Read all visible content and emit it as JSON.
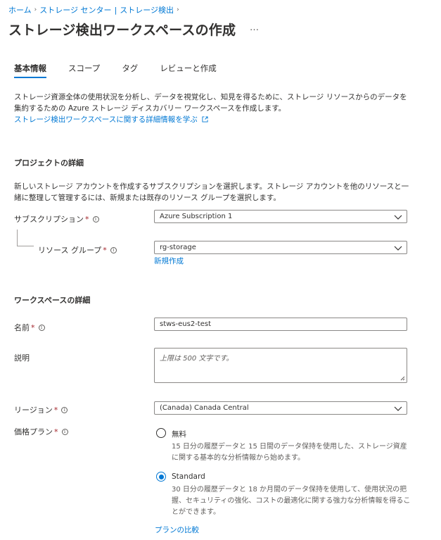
{
  "breadcrumb": {
    "home": "ホーム",
    "storage_center": "ストレージ センター",
    "separator_mid": "|",
    "storage_discovery": "ストレージ検出"
  },
  "page": {
    "title": "ストレージ検出ワークスペースの作成",
    "more": "…"
  },
  "tabs": [
    {
      "label": "基本情報",
      "active": true
    },
    {
      "label": "スコープ"
    },
    {
      "label": "タグ"
    },
    {
      "label": "レビューと作成"
    }
  ],
  "intro": {
    "text": "ストレージ資源全体の使用状況を分析し、データを視覚化し、知見を得るために、ストレージ リソースからのデータを集約するための Azure ストレージ ディスカバリー ワークスペースを作成します。",
    "link": "ストレージ検出ワークスペースに関する詳細情報を学ぶ"
  },
  "project": {
    "heading": "プロジェクトの詳細",
    "description": "新しいストレージ アカウントを作成するサブスクリプションを選択します。ストレージ アカウントを他のリソースと一緒に整理して管理するには、新規または既存のリソース グループを選択します。",
    "subscription_label": "サブスクリプション",
    "subscription_value": "Azure Subscription 1",
    "resource_group_label": "リソース グループ",
    "resource_group_value": "rg-storage",
    "create_new": "新規作成"
  },
  "workspace": {
    "heading": "ワークスペースの詳細",
    "name_label": "名前",
    "name_value": "stws-eus2-test",
    "description_label": "説明",
    "description_placeholder": "上限は 500 文字です。",
    "region_label": "リージョン",
    "region_value": "(Canada) Canada Central",
    "pricing_label": "価格プラン",
    "plans": [
      {
        "name": "無料",
        "description": "15 日分の履歴データと 15 日間のデータ保持を使用した、ストレージ資産に関する基本的な分析情報から始めます。",
        "selected": false
      },
      {
        "name": "Standard",
        "description": "30 日分の履歴データと 18 か月間のデータ保持を使用して、使用状況の把握、セキュリティの強化、コストの最適化に関する強力な分析情報を得ることができます。",
        "selected": true
      }
    ],
    "compare_plans": "プランの比較"
  },
  "required_marker": "*",
  "info_glyph": "i",
  "colors": {
    "accent": "#0078d4",
    "required": "#a4262c",
    "text": "#323130",
    "border": "#8a8886"
  }
}
